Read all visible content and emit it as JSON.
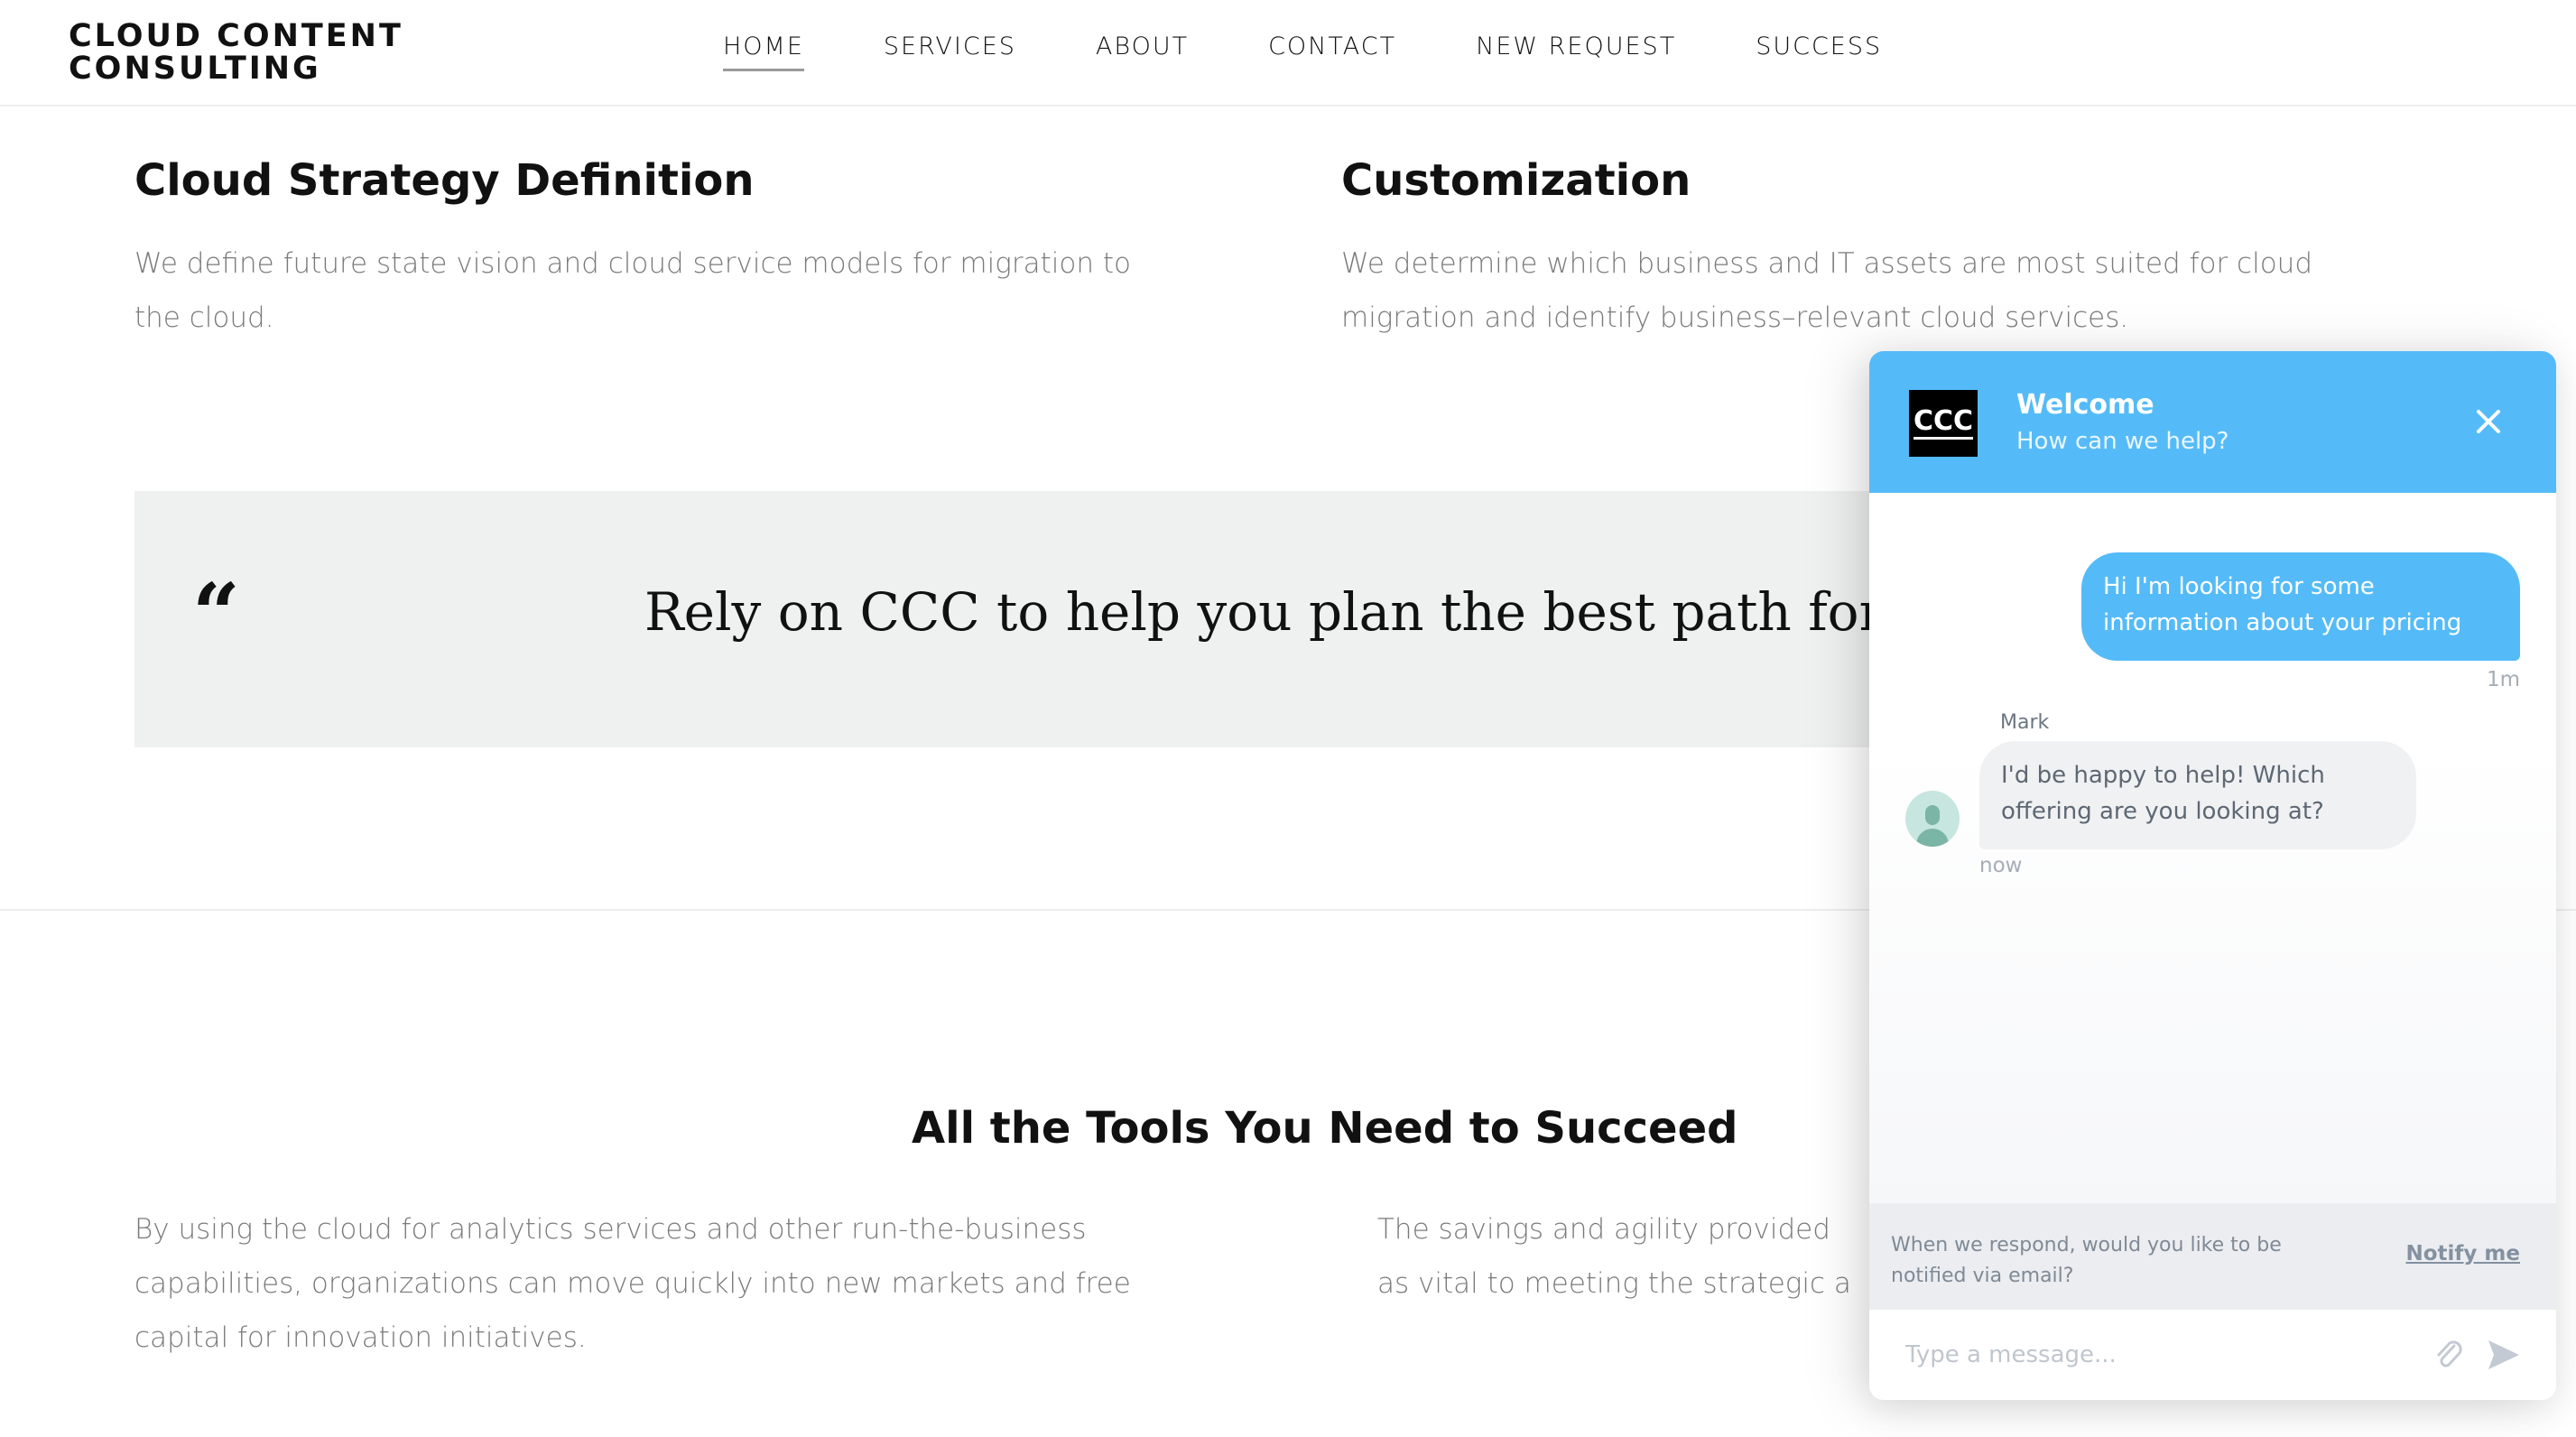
{
  "header": {
    "logo_line1": "CLOUD CONTENT",
    "logo_line2": "CONSULTING",
    "nav": [
      {
        "label": "HOME",
        "active": true
      },
      {
        "label": "SERVICES"
      },
      {
        "label": "ABOUT"
      },
      {
        "label": "CONTACT"
      },
      {
        "label": "NEW REQUEST"
      },
      {
        "label": "SUCCESS"
      }
    ]
  },
  "services": [
    {
      "title": "Cloud Strategy Definition",
      "text_line1": "We define future state vision and cloud service models for migration to",
      "text_line2": "the cloud."
    },
    {
      "title": "Customization",
      "text_line1": "We determine which business and IT assets are most suited for cloud",
      "text_line2": "migration and identify business–relevant cloud services."
    }
  ],
  "quote": {
    "mark": "“",
    "text": "Rely on CCC to help you plan the best path forward"
  },
  "tools": {
    "title": "All the Tools You Need to Succeed",
    "left_lines": [
      "By using the cloud for analytics services and other run-the-business",
      "capabilities, organizations can move quickly into new markets and free",
      "capital for innovation initiatives."
    ],
    "right_lines": [
      "The savings and agility provided",
      "as vital to meeting the strategic a"
    ]
  },
  "chat": {
    "logo_text": "CCC",
    "title": "Welcome",
    "subtitle": "How can we help?",
    "close_icon": "close-icon",
    "messages": [
      {
        "from": "user",
        "text": "Hi I'm looking for some information about your pricing",
        "time": "1m"
      },
      {
        "from": "agent",
        "name": "Mark",
        "text": "I'd be happy to help! Which offering are you looking at?",
        "time": "now"
      }
    ],
    "notify_text": "When we respond, would you like to be notified via email?",
    "notify_link": "Notify me",
    "input_placeholder": "Type a message...",
    "input_value": "",
    "colors": {
      "accent": "#55bbf8",
      "agent_bubble": "#f0f1f3",
      "avatar_bg": "#c6e6df"
    }
  }
}
